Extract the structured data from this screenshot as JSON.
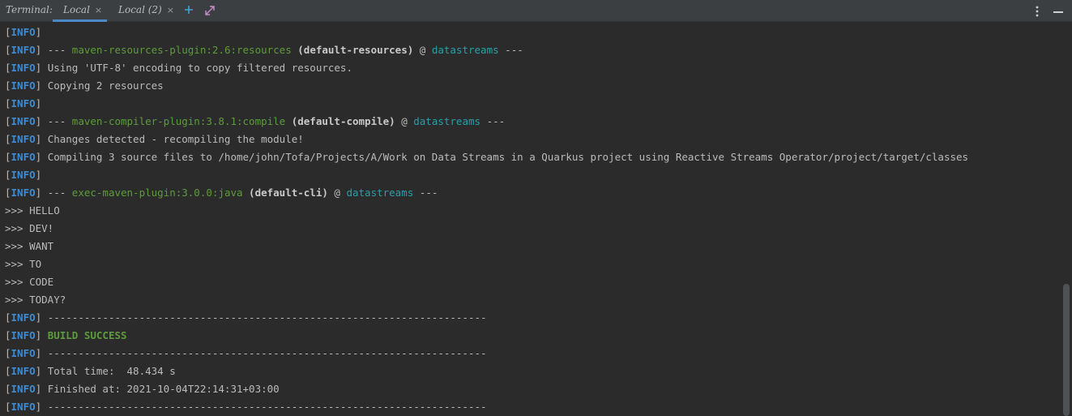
{
  "tabbar": {
    "label": "Terminal:",
    "tabs": [
      {
        "label": "Local",
        "close": "×"
      },
      {
        "label": "Local (2)",
        "close": "×"
      }
    ],
    "icons": [
      "add-icon",
      "expand-icon",
      "more-options-icon",
      "minimize-icon"
    ]
  },
  "lines": [
    {
      "parts": [
        {
          "cls": "b",
          "text": "["
        },
        {
          "cls": "info",
          "text": "INFO"
        },
        {
          "cls": "b",
          "text": "]"
        }
      ]
    },
    {
      "parts": [
        {
          "cls": "b",
          "text": "["
        },
        {
          "cls": "info",
          "text": "INFO"
        },
        {
          "cls": "b",
          "text": "] --- "
        },
        {
          "cls": "plug",
          "text": "maven-resources-plugin:2.6:resources"
        },
        {
          "cls": "b",
          "text": " "
        },
        {
          "cls": "bold",
          "text": "(default-resources)"
        },
        {
          "cls": "b",
          "text": " @ "
        },
        {
          "cls": "proj",
          "text": "datastreams"
        },
        {
          "cls": "b",
          "text": " ---"
        }
      ]
    },
    {
      "parts": [
        {
          "cls": "b",
          "text": "["
        },
        {
          "cls": "info",
          "text": "INFO"
        },
        {
          "cls": "b",
          "text": "] Using 'UTF-8' encoding to copy filtered resources."
        }
      ]
    },
    {
      "parts": [
        {
          "cls": "b",
          "text": "["
        },
        {
          "cls": "info",
          "text": "INFO"
        },
        {
          "cls": "b",
          "text": "] Copying 2 resources"
        }
      ]
    },
    {
      "parts": [
        {
          "cls": "b",
          "text": "["
        },
        {
          "cls": "info",
          "text": "INFO"
        },
        {
          "cls": "b",
          "text": "]"
        }
      ]
    },
    {
      "parts": [
        {
          "cls": "b",
          "text": "["
        },
        {
          "cls": "info",
          "text": "INFO"
        },
        {
          "cls": "b",
          "text": "] --- "
        },
        {
          "cls": "plug",
          "text": "maven-compiler-plugin:3.8.1:compile"
        },
        {
          "cls": "b",
          "text": " "
        },
        {
          "cls": "bold",
          "text": "(default-compile)"
        },
        {
          "cls": "b",
          "text": " @ "
        },
        {
          "cls": "proj",
          "text": "datastreams"
        },
        {
          "cls": "b",
          "text": " ---"
        }
      ]
    },
    {
      "parts": [
        {
          "cls": "b",
          "text": "["
        },
        {
          "cls": "info",
          "text": "INFO"
        },
        {
          "cls": "b",
          "text": "] Changes detected - recompiling the module!"
        }
      ]
    },
    {
      "parts": [
        {
          "cls": "b",
          "text": "["
        },
        {
          "cls": "info",
          "text": "INFO"
        },
        {
          "cls": "b",
          "text": "] Compiling 3 source files to /home/john/Tofa/Projects/A/Work on Data Streams in a Quarkus project using Reactive Streams Operator/project/target/classes"
        }
      ]
    },
    {
      "parts": [
        {
          "cls": "b",
          "text": "["
        },
        {
          "cls": "info",
          "text": "INFO"
        },
        {
          "cls": "b",
          "text": "]"
        }
      ]
    },
    {
      "parts": [
        {
          "cls": "b",
          "text": "["
        },
        {
          "cls": "info",
          "text": "INFO"
        },
        {
          "cls": "b",
          "text": "] --- "
        },
        {
          "cls": "plug",
          "text": "exec-maven-plugin:3.0.0:java"
        },
        {
          "cls": "b",
          "text": " "
        },
        {
          "cls": "bold",
          "text": "(default-cli)"
        },
        {
          "cls": "b",
          "text": " @ "
        },
        {
          "cls": "proj",
          "text": "datastreams"
        },
        {
          "cls": "b",
          "text": " ---"
        }
      ]
    },
    {
      "parts": [
        {
          "cls": "b",
          "text": ">>> HELLO"
        }
      ]
    },
    {
      "parts": [
        {
          "cls": "b",
          "text": ">>> DEV!"
        }
      ]
    },
    {
      "parts": [
        {
          "cls": "b",
          "text": ">>> WANT"
        }
      ]
    },
    {
      "parts": [
        {
          "cls": "b",
          "text": ">>> TO"
        }
      ]
    },
    {
      "parts": [
        {
          "cls": "b",
          "text": ">>> CODE"
        }
      ]
    },
    {
      "parts": [
        {
          "cls": "b",
          "text": ">>> TODAY?"
        }
      ]
    },
    {
      "parts": [
        {
          "cls": "b",
          "text": "["
        },
        {
          "cls": "info",
          "text": "INFO"
        },
        {
          "cls": "b",
          "text": "] ------------------------------------------------------------------------"
        }
      ]
    },
    {
      "parts": [
        {
          "cls": "b",
          "text": "["
        },
        {
          "cls": "info",
          "text": "INFO"
        },
        {
          "cls": "b",
          "text": "] "
        },
        {
          "cls": "ok",
          "text": "BUILD SUCCESS"
        }
      ]
    },
    {
      "parts": [
        {
          "cls": "b",
          "text": "["
        },
        {
          "cls": "info",
          "text": "INFO"
        },
        {
          "cls": "b",
          "text": "] ------------------------------------------------------------------------"
        }
      ]
    },
    {
      "parts": [
        {
          "cls": "b",
          "text": "["
        },
        {
          "cls": "info",
          "text": "INFO"
        },
        {
          "cls": "b",
          "text": "] Total time:  48.434 s"
        }
      ]
    },
    {
      "parts": [
        {
          "cls": "b",
          "text": "["
        },
        {
          "cls": "info",
          "text": "INFO"
        },
        {
          "cls": "b",
          "text": "] Finished at: 2021-10-04T22:14:31+03:00"
        }
      ]
    },
    {
      "parts": [
        {
          "cls": "b",
          "text": "["
        },
        {
          "cls": "info",
          "text": "INFO"
        },
        {
          "cls": "b",
          "text": "] ------------------------------------------------------------------------"
        }
      ]
    }
  ],
  "colors": {
    "background": "#2b2b2b",
    "tabbar": "#3c3f41",
    "info": "#3d8bd3",
    "plugin": "#5d9b3d",
    "project": "#2a9fa8",
    "success": "#5d9b3d",
    "active_tab_underline": "#4a88c7"
  }
}
